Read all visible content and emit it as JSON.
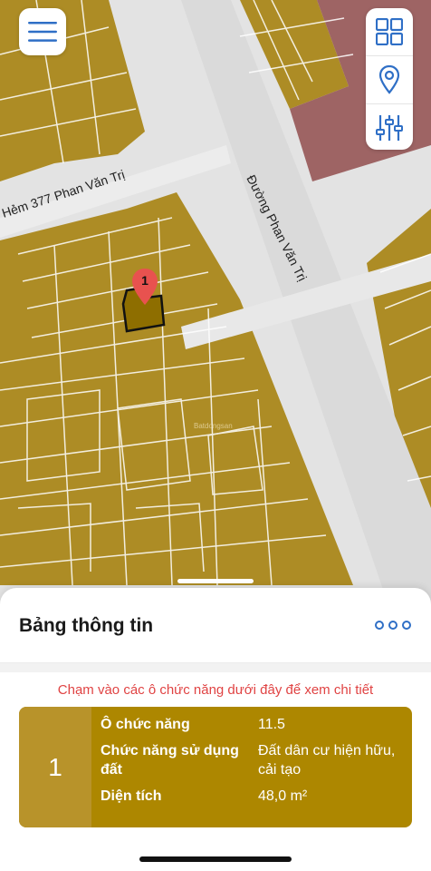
{
  "map": {
    "road_labels": {
      "alley": "Hẻm 377 Phan Văn Trị",
      "main_road": "Đường Phan Văn Trị"
    },
    "pin_number": "1",
    "watermark": "Batdongsan",
    "colors": {
      "land": "#ad8c25",
      "road": "#e3e3e3",
      "parcel_line": "#ffffff",
      "commercial_zone": "#9e6464",
      "selected_parcel": "#8e6e00",
      "pin": "#e8524f"
    }
  },
  "toolbar": {
    "menu_icon": "hamburger-menu-icon",
    "layers_icon": "grid-layers-icon",
    "location_icon": "map-pin-icon",
    "filter_icon": "sliders-icon"
  },
  "panel": {
    "title": "Bảng thông tin",
    "more_icon": "more-dots-icon",
    "hint": "Chạm vào các ô chức năng dưới đây để xem chi tiết",
    "card": {
      "index": "1",
      "rows": [
        {
          "label": "Ô chức năng",
          "value": "11.5"
        },
        {
          "label": "Chức năng sử dụng đất",
          "value": "Đất dân cư hiện hữu, cải tạo"
        },
        {
          "label": "Diện tích",
          "value": "48,0 m²"
        }
      ]
    }
  }
}
